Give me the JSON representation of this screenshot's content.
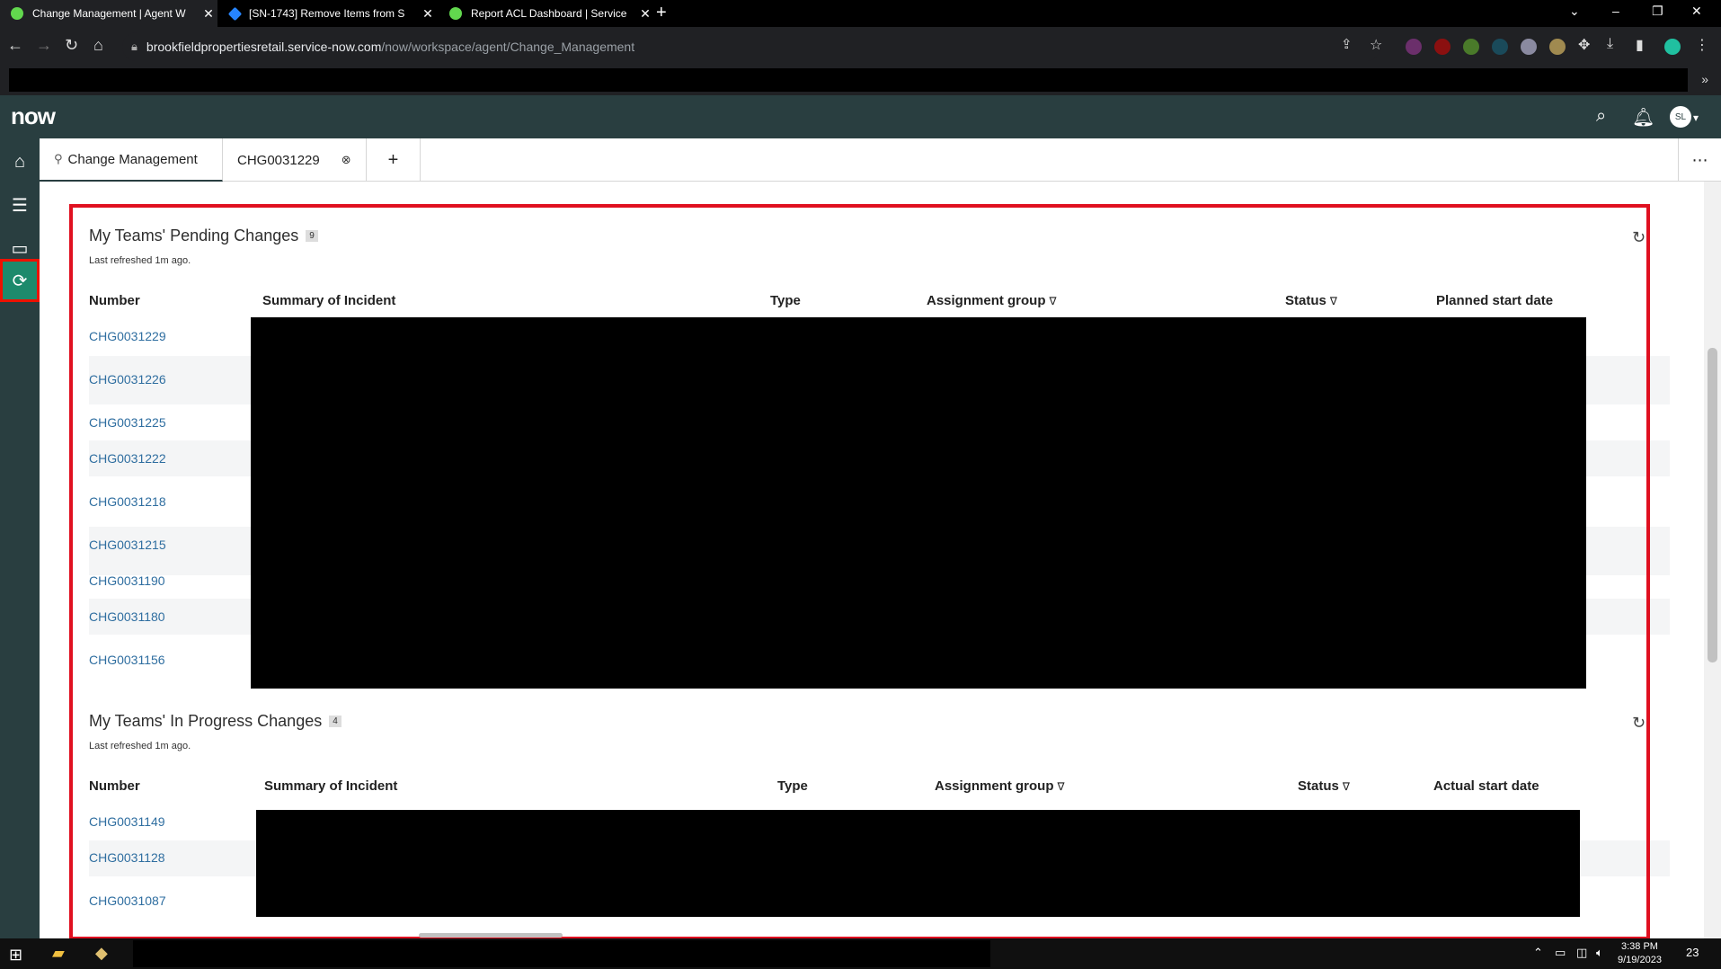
{
  "browser": {
    "tabs": [
      {
        "label": "Change Management | Agent W",
        "active": true
      },
      {
        "label": "[SN-1743] Remove Items from S",
        "active": false
      },
      {
        "label": "Report ACL Dashboard | Service",
        "active": false
      }
    ],
    "url_host": "brookfieldpropertiesretail.service-now.com",
    "url_path": "/now/workspace/agent/Change_Management"
  },
  "header": {
    "logo": "now",
    "avatar_initials": "SL"
  },
  "workspace_tabs": [
    {
      "label": "Change Management"
    },
    {
      "label": "CHG0031229"
    }
  ],
  "pending": {
    "title": "My Teams' Pending Changes",
    "count": "9",
    "refreshed": "Last refreshed 1m ago.",
    "columns": [
      "Number",
      "Summary of Incident",
      "Type",
      "Assignment group",
      "Status",
      "Planned start date"
    ],
    "rows": [
      "CHG0031229",
      "CHG0031226",
      "CHG0031225",
      "CHG0031222",
      "CHG0031218",
      "CHG0031215",
      "CHG0031190",
      "CHG0031180",
      "CHG0031156"
    ]
  },
  "in_progress": {
    "title": "My Teams' In Progress Changes",
    "count": "4",
    "refreshed": "Last refreshed 1m ago.",
    "columns": [
      "Number",
      "Summary of Incident",
      "Type",
      "Assignment group",
      "Status",
      "Actual start date"
    ],
    "rows": [
      "CHG0031149",
      "CHG0031128",
      "CHG0031087"
    ]
  },
  "taskbar": {
    "time": "3:38 PM",
    "date": "9/19/2023",
    "notifications": "23"
  },
  "colors": {
    "header_bg": "#293e40",
    "link": "#2f6ea0",
    "highlight_border": "#e01020",
    "rail_active": "#1d8a6c"
  }
}
